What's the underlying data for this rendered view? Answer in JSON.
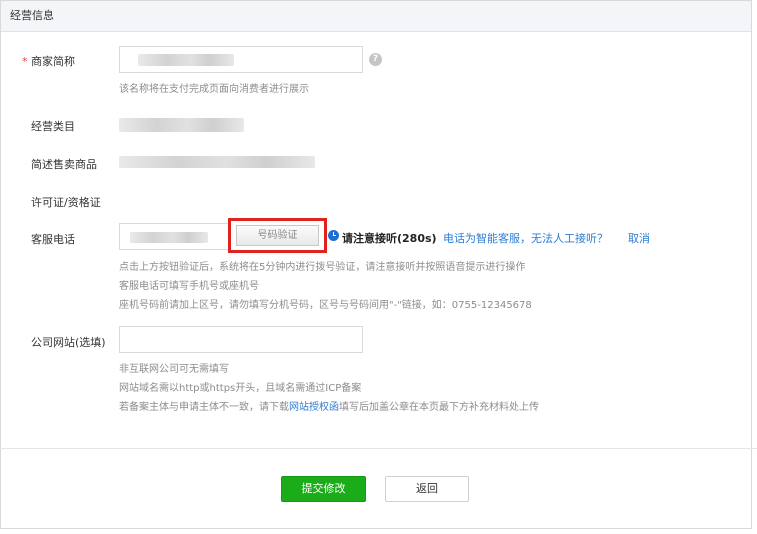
{
  "header": {
    "title": "经营信息"
  },
  "fields": {
    "merchant_name": {
      "required_mark": "*",
      "label": "商家简称",
      "hint": "该名称将在支付完成页面向消费者进行展示",
      "help_icon": "?"
    },
    "business_category": {
      "label": "经营类目"
    },
    "product_desc": {
      "label": "简述售卖商品"
    },
    "license": {
      "label": "许可证/资格证"
    },
    "service_phone": {
      "label": "客服电话",
      "verify_button": "号码验证",
      "notice": "请注意接听(280s)",
      "smart_service_link": "电话为智能客服，无法人工接听？",
      "cancel_link": "取消",
      "hint1": "点击上方按钮验证后，系统将在5分钟内进行拨号验证，请注意接听并按照语音提示进行操作",
      "hint2": "客服电话可填写手机号或座机号",
      "hint3": "座机号码前请加上区号，请勿填写分机号码，区号与号码间用\"-\"链接，如：0755-12345678"
    },
    "website": {
      "label": "公司网站(选填)",
      "value": "",
      "hint1": "非互联网公司可无需填写",
      "hint2": "网站域名需以http或https开头，且域名需通过ICP备案",
      "hint3_before": "若备案主体与申请主体不一致，请下载",
      "hint3_link": "网站授权函",
      "hint3_after": "填写后加盖公章在本页最下方补充材料处上传"
    }
  },
  "actions": {
    "submit": "提交修改",
    "back": "返回"
  },
  "colors": {
    "primary": "#1aad19",
    "link": "#2d7ed4",
    "required": "#e64340",
    "highlight_box": "#e0231e"
  }
}
